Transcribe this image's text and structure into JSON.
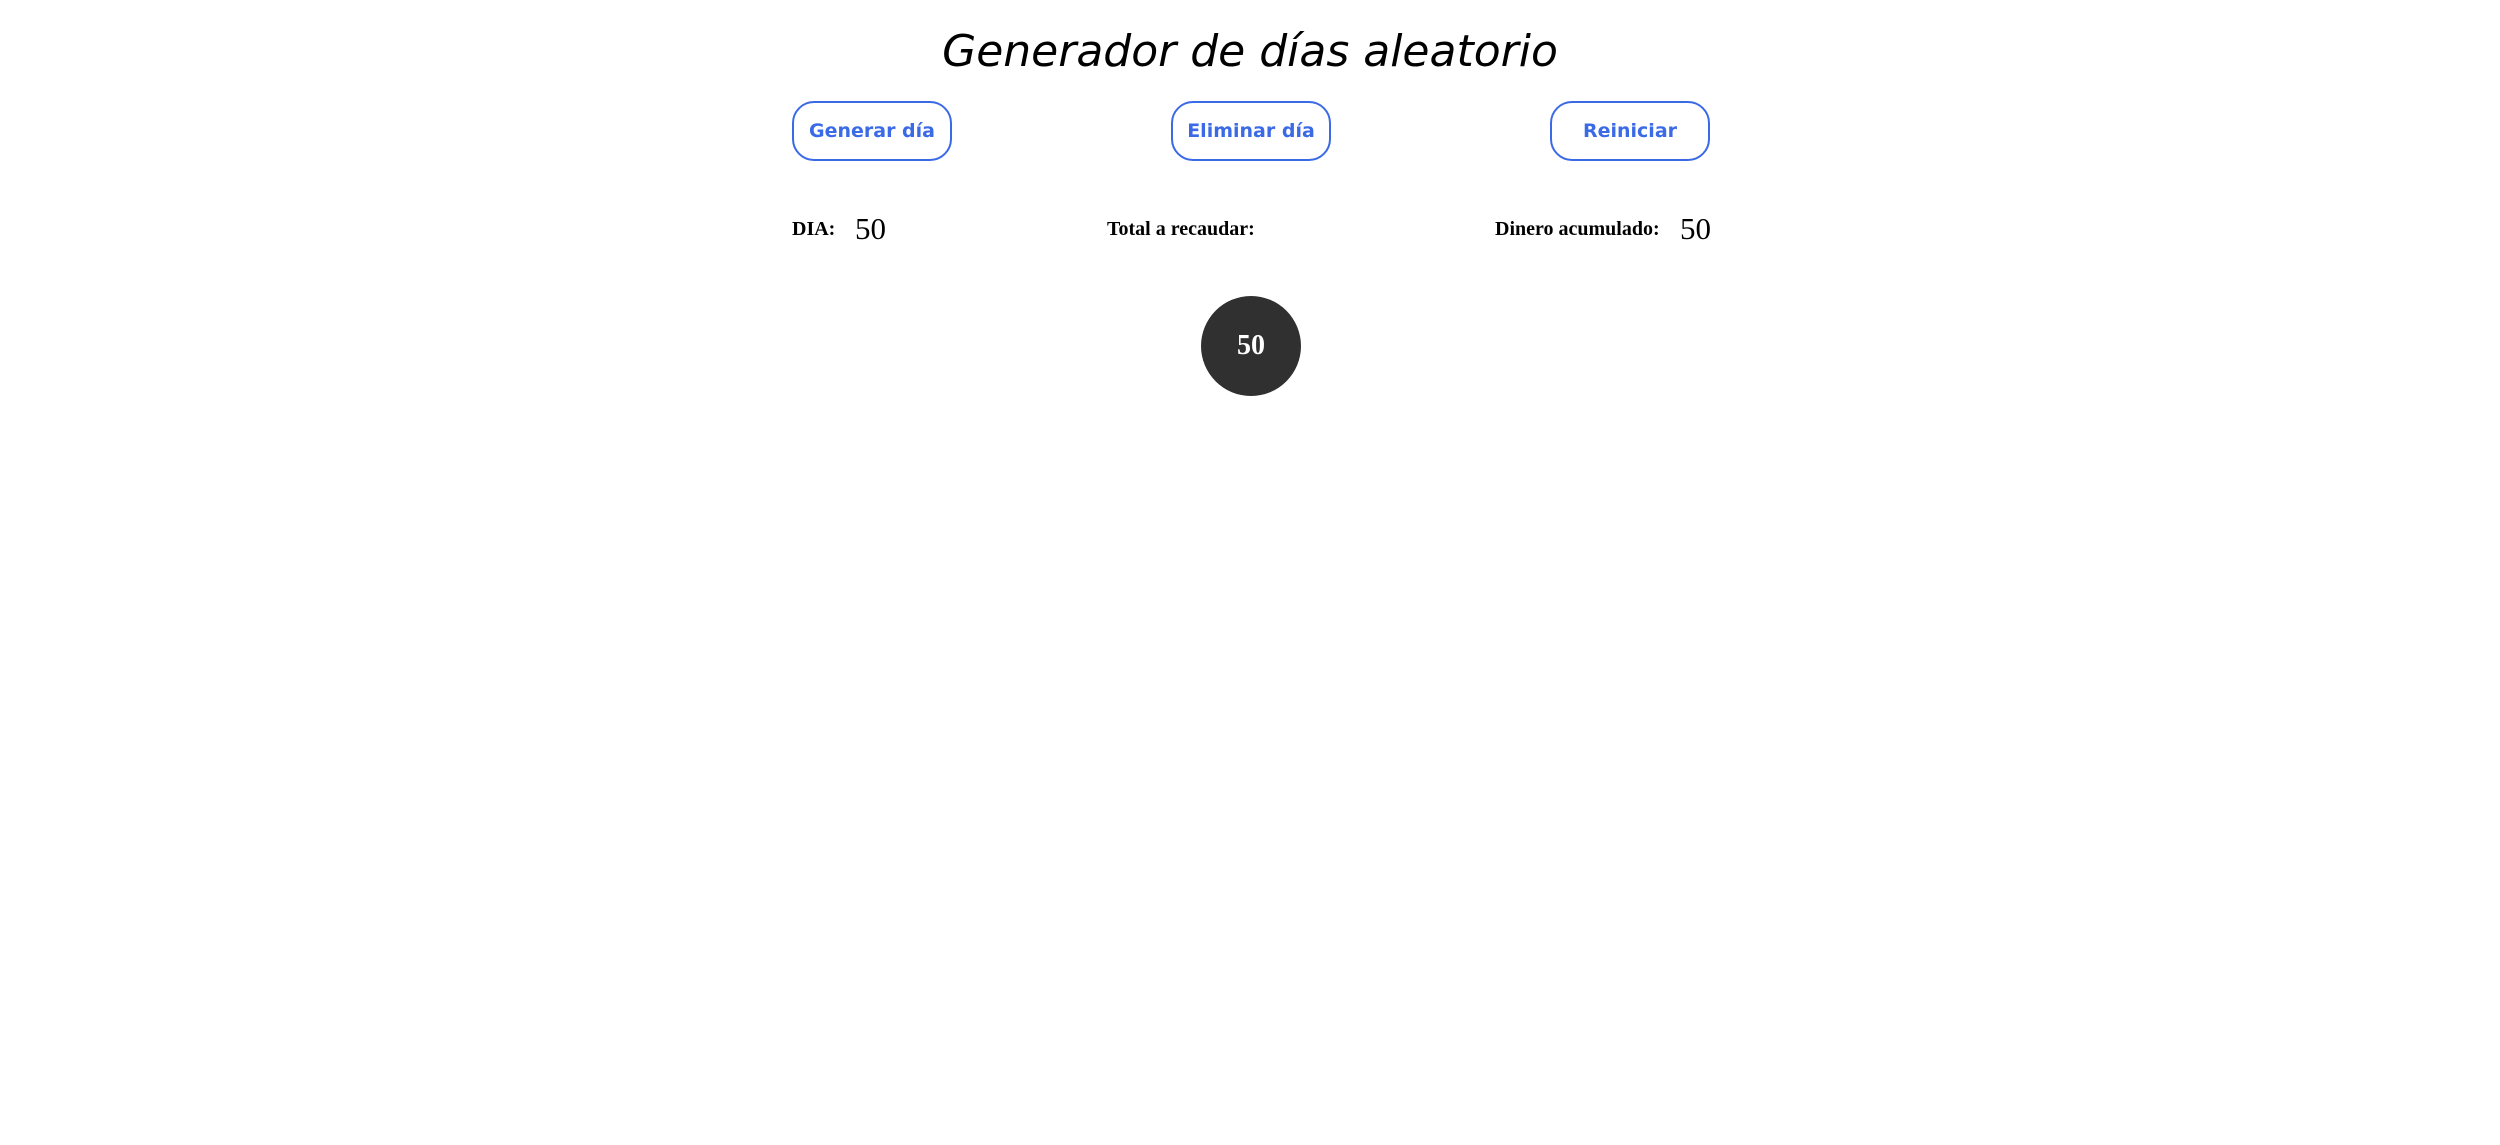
{
  "header": {
    "title": "Generador de días aleatorio"
  },
  "controls": {
    "generate_label": "Generar día",
    "remove_label": "Eliminar día",
    "reset_label": "Reiniciar"
  },
  "stats": {
    "dia_label": "DIA:",
    "dia_value": "50",
    "total_label": "Total a recaudar:",
    "total_value": "",
    "dinero_label": "Dinero acumulado:",
    "dinero_value": "50"
  },
  "days": {
    "generated": [
      "50"
    ]
  },
  "colors": {
    "accent": "#3b6ae6",
    "ball": "#303030",
    "background": "#ffffff"
  }
}
